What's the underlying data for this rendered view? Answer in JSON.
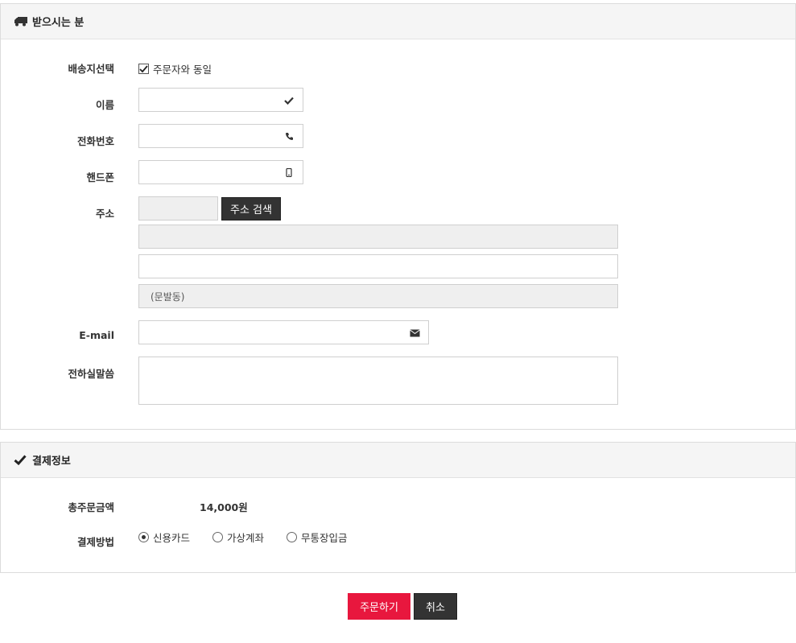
{
  "recipient": {
    "section_title": "받으시는 분",
    "delivery_select": {
      "label": "배송지선택",
      "same_as_orderer": "주문자와 동일",
      "checked": true
    },
    "name": {
      "label": "이름",
      "value": ""
    },
    "phone": {
      "label": "전화번호",
      "value": ""
    },
    "mobile": {
      "label": "핸드폰",
      "value": ""
    },
    "address": {
      "label": "주소",
      "zipcode": "",
      "search_button": "주소 검색",
      "line1": "",
      "line2": "",
      "extra": "(문발동)"
    },
    "email": {
      "label": "E-mail",
      "value": ""
    },
    "message": {
      "label": "전하실말씀",
      "value": ""
    }
  },
  "payment": {
    "section_title": "결제정보",
    "total": {
      "label": "총주문금액",
      "value": "14,000원"
    },
    "method": {
      "label": "결제방법",
      "options": [
        "신용카드",
        "가상계좌",
        "무통장입금"
      ],
      "selected": "신용카드"
    }
  },
  "actions": {
    "order": "주문하기",
    "cancel": "취소"
  },
  "colors": {
    "accent": "#e8173e",
    "dark_button": "#333333",
    "header_bg": "#f5f5f5"
  }
}
